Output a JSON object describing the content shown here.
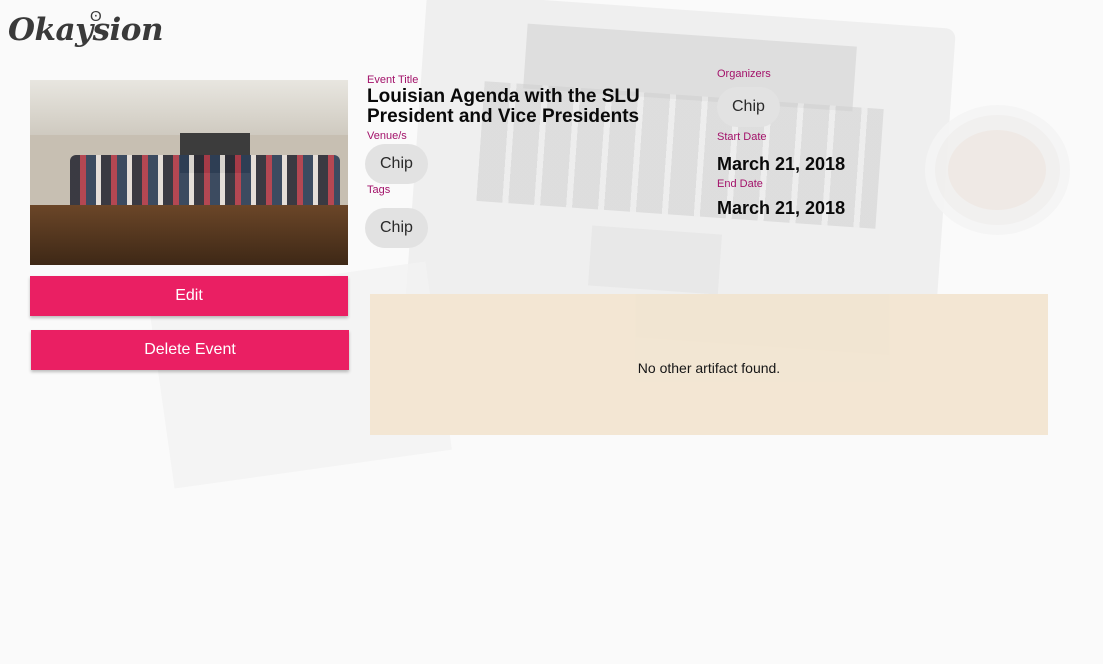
{
  "app": {
    "logo_text": "Okaysion"
  },
  "event": {
    "title_label": "Event Title",
    "title": "Louisian Agenda with the SLU President and Vice Presidents",
    "venues_label": "Venue/s",
    "venues": [
      "Chip"
    ],
    "tags_label": "Tags",
    "tags": [
      "Chip"
    ],
    "organizers_label": "Organizers",
    "organizers": [
      "Chip"
    ],
    "start_label": "Start Date",
    "start_date": "March 21, 2018",
    "end_label": "End Date",
    "end_date": "March 21, 2018"
  },
  "actions": {
    "edit_label": "Edit",
    "delete_label": "Delete Event"
  },
  "artifacts": {
    "empty_text": "No other artifact found."
  },
  "colors": {
    "accent": "#ea1f63",
    "label": "#a3126a",
    "chip_bg": "#e2e2e2",
    "artifact_bg": "#f2e5d1"
  }
}
